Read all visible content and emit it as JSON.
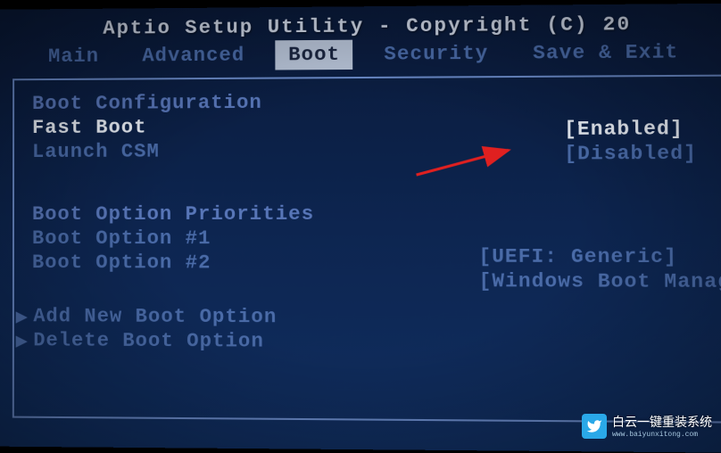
{
  "title": "Aptio Setup Utility - Copyright (C) 20",
  "tabs": {
    "main": "Main",
    "advanced": "Advanced",
    "boot": "Boot",
    "security": "Security",
    "saveexit": "Save & Exit"
  },
  "bootConfig": {
    "header": "Boot Configuration",
    "fastBoot": {
      "label": "Fast Boot",
      "value": "[Enabled]"
    },
    "launchCSM": {
      "label": "Launch CSM",
      "value": "[Disabled]"
    }
  },
  "bootPriorities": {
    "header": "Boot Option Priorities",
    "option1": {
      "label": "Boot Option #1",
      "value": "[UEFI: Generic]"
    },
    "option2": {
      "label": "Boot Option #2",
      "value": "[Windows Boot Manag"
    }
  },
  "actions": {
    "addNew": "Add New Boot Option",
    "delete": "Delete Boot Option"
  },
  "watermark": {
    "text": "白云一键重装系统",
    "url": "www.baiyunxitong.com"
  }
}
